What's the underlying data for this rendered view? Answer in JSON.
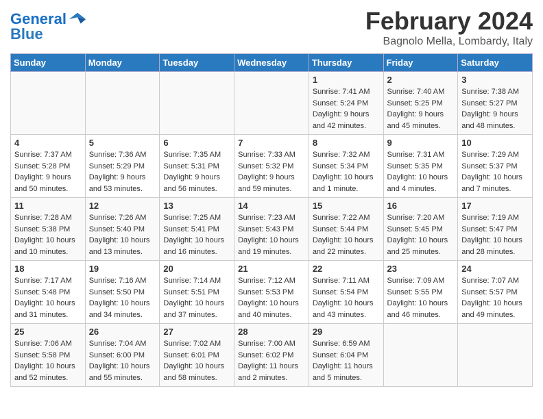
{
  "header": {
    "logo_line1": "General",
    "logo_line2": "Blue",
    "month_title": "February 2024",
    "location": "Bagnolo Mella, Lombardy, Italy"
  },
  "weekdays": [
    "Sunday",
    "Monday",
    "Tuesday",
    "Wednesday",
    "Thursday",
    "Friday",
    "Saturday"
  ],
  "weeks": [
    [
      {
        "day": "",
        "sunrise": "",
        "sunset": "",
        "daylight": ""
      },
      {
        "day": "",
        "sunrise": "",
        "sunset": "",
        "daylight": ""
      },
      {
        "day": "",
        "sunrise": "",
        "sunset": "",
        "daylight": ""
      },
      {
        "day": "",
        "sunrise": "",
        "sunset": "",
        "daylight": ""
      },
      {
        "day": "1",
        "sunrise": "Sunrise: 7:41 AM",
        "sunset": "Sunset: 5:24 PM",
        "daylight": "Daylight: 9 hours and 42 minutes."
      },
      {
        "day": "2",
        "sunrise": "Sunrise: 7:40 AM",
        "sunset": "Sunset: 5:25 PM",
        "daylight": "Daylight: 9 hours and 45 minutes."
      },
      {
        "day": "3",
        "sunrise": "Sunrise: 7:38 AM",
        "sunset": "Sunset: 5:27 PM",
        "daylight": "Daylight: 9 hours and 48 minutes."
      }
    ],
    [
      {
        "day": "4",
        "sunrise": "Sunrise: 7:37 AM",
        "sunset": "Sunset: 5:28 PM",
        "daylight": "Daylight: 9 hours and 50 minutes."
      },
      {
        "day": "5",
        "sunrise": "Sunrise: 7:36 AM",
        "sunset": "Sunset: 5:29 PM",
        "daylight": "Daylight: 9 hours and 53 minutes."
      },
      {
        "day": "6",
        "sunrise": "Sunrise: 7:35 AM",
        "sunset": "Sunset: 5:31 PM",
        "daylight": "Daylight: 9 hours and 56 minutes."
      },
      {
        "day": "7",
        "sunrise": "Sunrise: 7:33 AM",
        "sunset": "Sunset: 5:32 PM",
        "daylight": "Daylight: 9 hours and 59 minutes."
      },
      {
        "day": "8",
        "sunrise": "Sunrise: 7:32 AM",
        "sunset": "Sunset: 5:34 PM",
        "daylight": "Daylight: 10 hours and 1 minute."
      },
      {
        "day": "9",
        "sunrise": "Sunrise: 7:31 AM",
        "sunset": "Sunset: 5:35 PM",
        "daylight": "Daylight: 10 hours and 4 minutes."
      },
      {
        "day": "10",
        "sunrise": "Sunrise: 7:29 AM",
        "sunset": "Sunset: 5:37 PM",
        "daylight": "Daylight: 10 hours and 7 minutes."
      }
    ],
    [
      {
        "day": "11",
        "sunrise": "Sunrise: 7:28 AM",
        "sunset": "Sunset: 5:38 PM",
        "daylight": "Daylight: 10 hours and 10 minutes."
      },
      {
        "day": "12",
        "sunrise": "Sunrise: 7:26 AM",
        "sunset": "Sunset: 5:40 PM",
        "daylight": "Daylight: 10 hours and 13 minutes."
      },
      {
        "day": "13",
        "sunrise": "Sunrise: 7:25 AM",
        "sunset": "Sunset: 5:41 PM",
        "daylight": "Daylight: 10 hours and 16 minutes."
      },
      {
        "day": "14",
        "sunrise": "Sunrise: 7:23 AM",
        "sunset": "Sunset: 5:43 PM",
        "daylight": "Daylight: 10 hours and 19 minutes."
      },
      {
        "day": "15",
        "sunrise": "Sunrise: 7:22 AM",
        "sunset": "Sunset: 5:44 PM",
        "daylight": "Daylight: 10 hours and 22 minutes."
      },
      {
        "day": "16",
        "sunrise": "Sunrise: 7:20 AM",
        "sunset": "Sunset: 5:45 PM",
        "daylight": "Daylight: 10 hours and 25 minutes."
      },
      {
        "day": "17",
        "sunrise": "Sunrise: 7:19 AM",
        "sunset": "Sunset: 5:47 PM",
        "daylight": "Daylight: 10 hours and 28 minutes."
      }
    ],
    [
      {
        "day": "18",
        "sunrise": "Sunrise: 7:17 AM",
        "sunset": "Sunset: 5:48 PM",
        "daylight": "Daylight: 10 hours and 31 minutes."
      },
      {
        "day": "19",
        "sunrise": "Sunrise: 7:16 AM",
        "sunset": "Sunset: 5:50 PM",
        "daylight": "Daylight: 10 hours and 34 minutes."
      },
      {
        "day": "20",
        "sunrise": "Sunrise: 7:14 AM",
        "sunset": "Sunset: 5:51 PM",
        "daylight": "Daylight: 10 hours and 37 minutes."
      },
      {
        "day": "21",
        "sunrise": "Sunrise: 7:12 AM",
        "sunset": "Sunset: 5:53 PM",
        "daylight": "Daylight: 10 hours and 40 minutes."
      },
      {
        "day": "22",
        "sunrise": "Sunrise: 7:11 AM",
        "sunset": "Sunset: 5:54 PM",
        "daylight": "Daylight: 10 hours and 43 minutes."
      },
      {
        "day": "23",
        "sunrise": "Sunrise: 7:09 AM",
        "sunset": "Sunset: 5:55 PM",
        "daylight": "Daylight: 10 hours and 46 minutes."
      },
      {
        "day": "24",
        "sunrise": "Sunrise: 7:07 AM",
        "sunset": "Sunset: 5:57 PM",
        "daylight": "Daylight: 10 hours and 49 minutes."
      }
    ],
    [
      {
        "day": "25",
        "sunrise": "Sunrise: 7:06 AM",
        "sunset": "Sunset: 5:58 PM",
        "daylight": "Daylight: 10 hours and 52 minutes."
      },
      {
        "day": "26",
        "sunrise": "Sunrise: 7:04 AM",
        "sunset": "Sunset: 6:00 PM",
        "daylight": "Daylight: 10 hours and 55 minutes."
      },
      {
        "day": "27",
        "sunrise": "Sunrise: 7:02 AM",
        "sunset": "Sunset: 6:01 PM",
        "daylight": "Daylight: 10 hours and 58 minutes."
      },
      {
        "day": "28",
        "sunrise": "Sunrise: 7:00 AM",
        "sunset": "Sunset: 6:02 PM",
        "daylight": "Daylight: 11 hours and 2 minutes."
      },
      {
        "day": "29",
        "sunrise": "Sunrise: 6:59 AM",
        "sunset": "Sunset: 6:04 PM",
        "daylight": "Daylight: 11 hours and 5 minutes."
      },
      {
        "day": "",
        "sunrise": "",
        "sunset": "",
        "daylight": ""
      },
      {
        "day": "",
        "sunrise": "",
        "sunset": "",
        "daylight": ""
      }
    ]
  ]
}
